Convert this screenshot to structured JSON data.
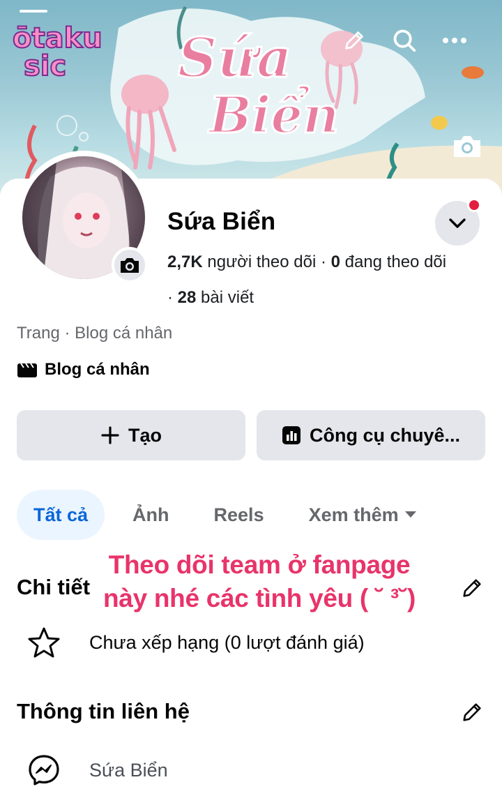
{
  "cover": {
    "logo_text_line1": "ōtaku",
    "logo_text_line2": "sic",
    "banner_line1": "Sứa",
    "banner_line2": "Biển"
  },
  "header_icons": [
    "menu-icon",
    "pencil-icon",
    "search-icon",
    "more-icon"
  ],
  "profile": {
    "name": "Sứa Biển",
    "followers_count": "2,7K",
    "followers_label": " người theo dõi · ",
    "following_count": "0",
    "following_label": " đang theo dõi",
    "posts_prefix": "· ",
    "posts_count": "28",
    "posts_label": " bài viết",
    "category": "Trang · Blog cá nhân",
    "blog_label": "Blog cá nhân"
  },
  "actions": {
    "create_label": "Tạo",
    "tools_label": "Công cụ chuyê..."
  },
  "tabs": [
    {
      "label": "Tất cả",
      "active": true
    },
    {
      "label": "Ảnh",
      "active": false
    },
    {
      "label": "Reels",
      "active": false
    },
    {
      "label": "Xem thêm",
      "active": false
    }
  ],
  "details": {
    "title": "Chi tiết",
    "rating": "Chưa xếp hạng (0 lượt đánh giá)"
  },
  "overlay": {
    "line1": "Theo dõi team ở fanpage",
    "line2": "này nhé các tình yêu ( ˘ ³˘)"
  },
  "contact": {
    "title": "Thông tin liên hệ",
    "messenger_name": "Sứa Biển"
  },
  "colors": {
    "accent_blue": "#0a66d8",
    "tab_active_bg": "#ebf5ff",
    "button_bg": "#e4e6eb",
    "notification_red": "#e41e3f",
    "overlay_pink": "#e8346a"
  }
}
